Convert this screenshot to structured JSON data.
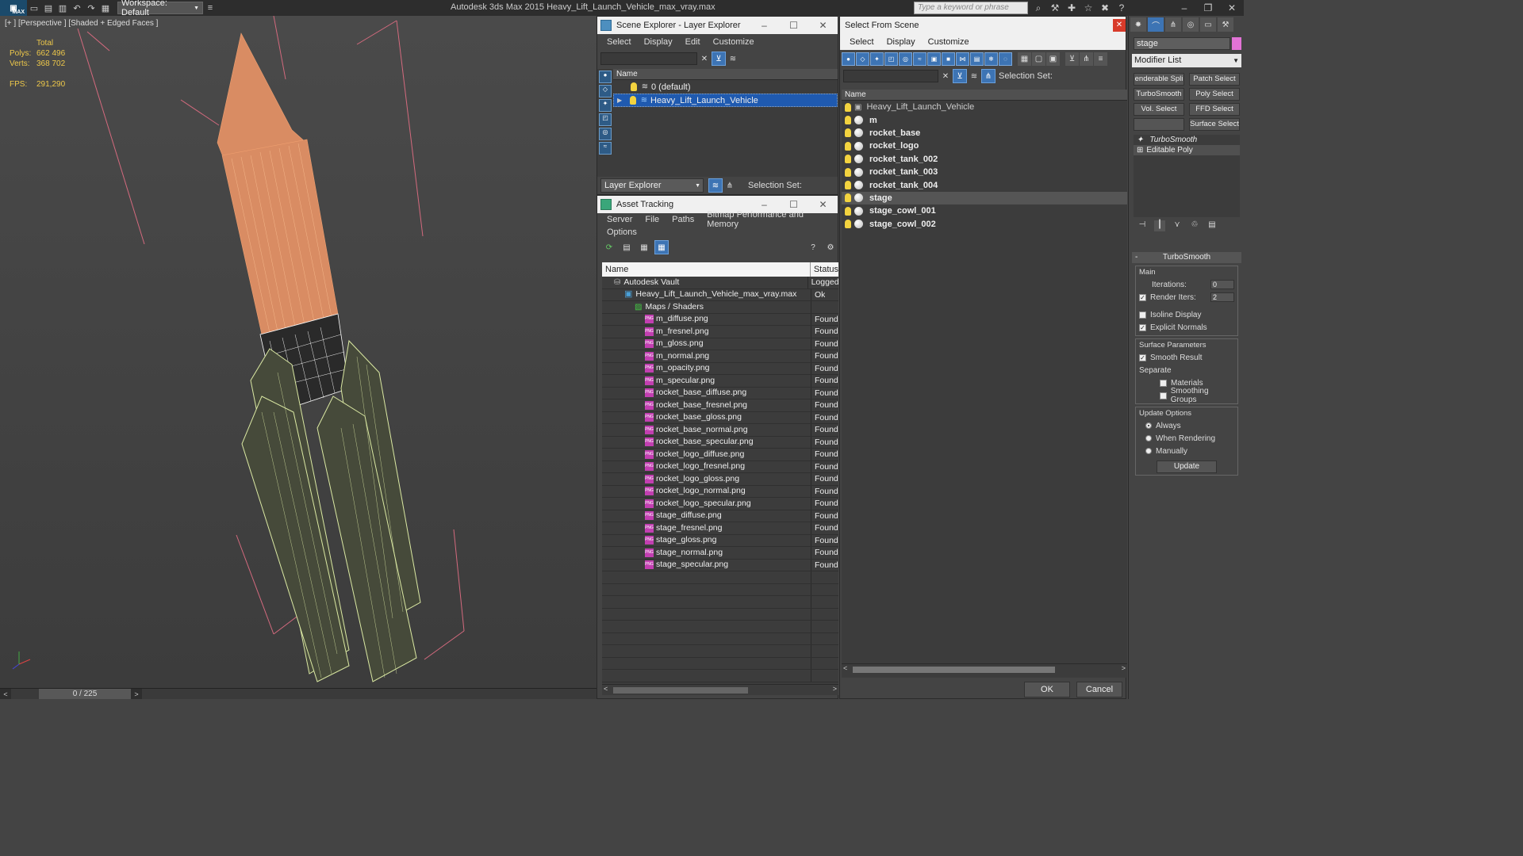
{
  "titlebar": {
    "logo": "MAX",
    "workspace": "Workspace: Default",
    "title": "Autodesk 3ds Max  2015    Heavy_Lift_Launch_Vehicle_max_vray.max",
    "search_placeholder": "Type a keyword or phrase"
  },
  "viewport": {
    "label": "[+ ] [Perspective ] [Shaded + Edged Faces ]",
    "stats": {
      "total_label": "Total",
      "polys_label": "Polys:",
      "polys": "662 496",
      "verts_label": "Verts:",
      "verts": "368 702",
      "fps_label": "FPS:",
      "fps": "291,290"
    },
    "model_colors": {
      "top": "#e0895a",
      "boosters": "#d9e8a0"
    }
  },
  "timeslider": {
    "frame": "0 / 225"
  },
  "scene_explorer": {
    "title": "Scene Explorer - Layer Explorer",
    "menu": [
      "Select",
      "Display",
      "Edit",
      "Customize"
    ],
    "column": "Name",
    "rows": [
      "0 (default)",
      "Heavy_Lift_Launch_Vehicle"
    ],
    "footer_dropdown": "Layer Explorer",
    "selection_set_label": "Selection Set:"
  },
  "asset_tracking": {
    "title": "Asset Tracking",
    "menu": [
      "Server",
      "File",
      "Paths",
      "Bitmap Performance and Memory",
      "Options"
    ],
    "columns": {
      "name": "Name",
      "status": "Status"
    },
    "rows": [
      {
        "name": "Autodesk Vault",
        "status": "Logged",
        "level": 1,
        "icon": "vault-icon"
      },
      {
        "name": "Heavy_Lift_Launch_Vehicle_max_vray.max",
        "status": "Ok",
        "level": 2,
        "icon": "max-file-icon"
      },
      {
        "name": "Maps / Shaders",
        "status": "",
        "level": 3,
        "icon": "maps-icon"
      },
      {
        "name": "m_diffuse.png",
        "status": "Found",
        "level": 4,
        "icon": "png-icon"
      },
      {
        "name": "m_fresnel.png",
        "status": "Found",
        "level": 4,
        "icon": "png-icon"
      },
      {
        "name": "m_gloss.png",
        "status": "Found",
        "level": 4,
        "icon": "png-icon"
      },
      {
        "name": "m_normal.png",
        "status": "Found",
        "level": 4,
        "icon": "png-icon"
      },
      {
        "name": "m_opacity.png",
        "status": "Found",
        "level": 4,
        "icon": "png-icon"
      },
      {
        "name": "m_specular.png",
        "status": "Found",
        "level": 4,
        "icon": "png-icon"
      },
      {
        "name": "rocket_base_diffuse.png",
        "status": "Found",
        "level": 4,
        "icon": "png-icon"
      },
      {
        "name": "rocket_base_fresnel.png",
        "status": "Found",
        "level": 4,
        "icon": "png-icon"
      },
      {
        "name": "rocket_base_gloss.png",
        "status": "Found",
        "level": 4,
        "icon": "png-icon"
      },
      {
        "name": "rocket_base_normal.png",
        "status": "Found",
        "level": 4,
        "icon": "png-icon"
      },
      {
        "name": "rocket_base_specular.png",
        "status": "Found",
        "level": 4,
        "icon": "png-icon"
      },
      {
        "name": "rocket_logo_diffuse.png",
        "status": "Found",
        "level": 4,
        "icon": "png-icon"
      },
      {
        "name": "rocket_logo_fresnel.png",
        "status": "Found",
        "level": 4,
        "icon": "png-icon"
      },
      {
        "name": "rocket_logo_gloss.png",
        "status": "Found",
        "level": 4,
        "icon": "png-icon"
      },
      {
        "name": "rocket_logo_normal.png",
        "status": "Found",
        "level": 4,
        "icon": "png-icon"
      },
      {
        "name": "rocket_logo_specular.png",
        "status": "Found",
        "level": 4,
        "icon": "png-icon"
      },
      {
        "name": "stage_diffuse.png",
        "status": "Found",
        "level": 4,
        "icon": "png-icon"
      },
      {
        "name": "stage_fresnel.png",
        "status": "Found",
        "level": 4,
        "icon": "png-icon"
      },
      {
        "name": "stage_gloss.png",
        "status": "Found",
        "level": 4,
        "icon": "png-icon"
      },
      {
        "name": "stage_normal.png",
        "status": "Found",
        "level": 4,
        "icon": "png-icon"
      },
      {
        "name": "stage_specular.png",
        "status": "Found",
        "level": 4,
        "icon": "png-icon"
      }
    ]
  },
  "select_from_scene": {
    "title": "Select From Scene",
    "menu": [
      "Select",
      "Display",
      "Customize"
    ],
    "selection_set_label": "Selection Set:",
    "column": "Name",
    "objects": [
      "Heavy_Lift_Launch_Vehicle",
      "m",
      "rocket_base",
      "rocket_logo",
      "rocket_tank_002",
      "rocket_tank_003",
      "rocket_tank_004",
      "stage",
      "stage_cowl_001",
      "stage_cowl_002"
    ],
    "highlighted": "stage",
    "ok_label": "OK",
    "cancel_label": "Cancel"
  },
  "command_panel": {
    "object_name": "stage",
    "object_color": "#e273d6",
    "modifier_list": "Modifier List",
    "buttons": [
      "enderable Spli",
      "Patch Select",
      "TurboSmooth",
      "Poly Select",
      "Vol. Select",
      "FFD Select",
      "",
      "Surface Select"
    ],
    "stack": [
      "TurboSmooth",
      "Editable Poly"
    ],
    "rollout": {
      "title": "TurboSmooth",
      "main_label": "Main",
      "iterations_label": "Iterations:",
      "iterations": "0",
      "render_iters_label": "Render Iters:",
      "render_iters": "2",
      "render_iters_checked": true,
      "isoline_label": "Isoline Display",
      "isoline_checked": false,
      "explicit_label": "Explicit Normals",
      "explicit_checked": true,
      "surface_label": "Surface Parameters",
      "smooth_label": "Smooth Result",
      "smooth_checked": true,
      "separate_label": "Separate",
      "materials_label": "Materials",
      "smoothing_groups_label": "Smoothing Groups",
      "update_options_label": "Update Options",
      "always_label": "Always",
      "when_rendering_label": "When Rendering",
      "manually_label": "Manually",
      "update_mode": "Always",
      "update_button": "Update"
    }
  }
}
